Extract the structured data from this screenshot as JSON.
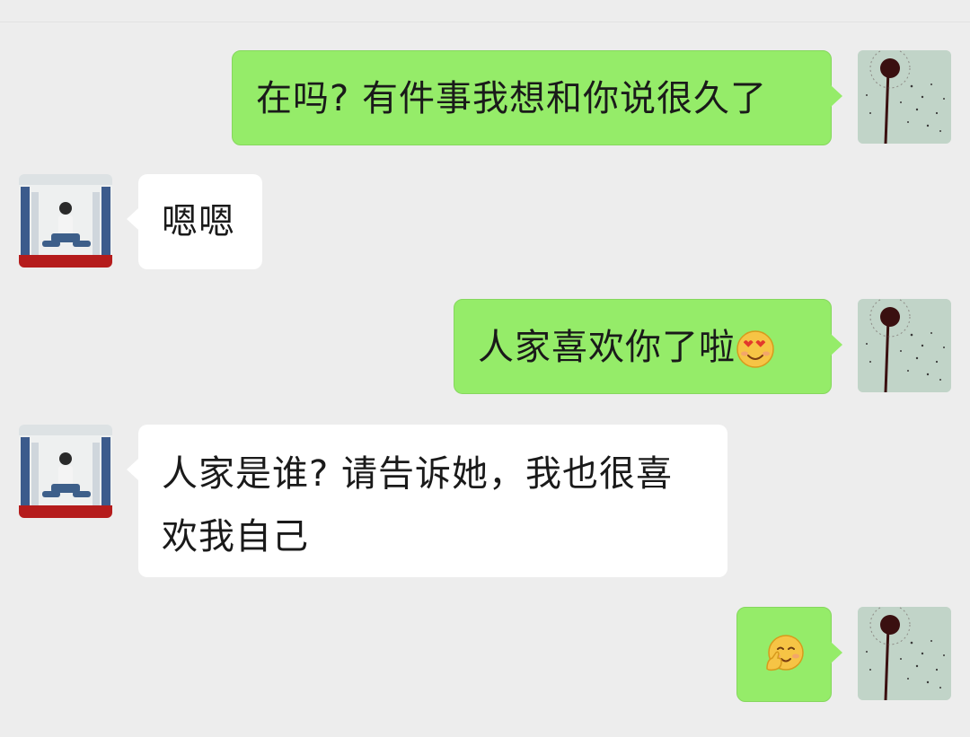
{
  "chat": {
    "messages": [
      {
        "side": "out",
        "text": "在吗? 有件事我想和你说很久了"
      },
      {
        "side": "in",
        "text": "嗯嗯"
      },
      {
        "side": "out",
        "text": "人家喜欢你了啦",
        "emoji": "heart-eyes-smile-emoji"
      },
      {
        "side": "in",
        "line1": "人家是谁? 请告诉她，我也很喜",
        "line2": "欢我自己"
      },
      {
        "side": "out",
        "emoji": "shy-hand-face-emoji"
      }
    ]
  },
  "colors": {
    "background": "#ededed",
    "outgoing_bubble": "#95ec69",
    "incoming_bubble": "#ffffff",
    "text": "#1a1a1a"
  },
  "avatars": {
    "self": "dandelion-photo-avatar",
    "contact": "person-sitting-photo-avatar"
  }
}
